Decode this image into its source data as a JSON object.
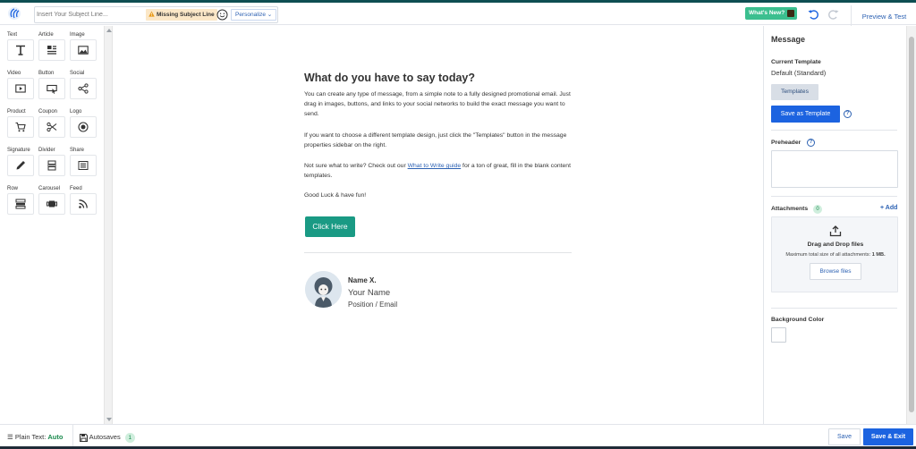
{
  "colors": {
    "accent": "#1c63e0",
    "cta": "#1a9a84",
    "whats_new": "#3bbf8f",
    "warning_bg": "#fbe7c7",
    "success": "#1b8a4e"
  },
  "topbar": {
    "logo_icon": "app-logo-icon",
    "subject_placeholder": "Insert Your Subject Line...",
    "missing_subject": "Missing Subject Line",
    "personalize": "Personalize",
    "whats_new": "What's New?",
    "preview_test": "Preview & Test"
  },
  "blocks": [
    {
      "label": "Text",
      "icon": "text-icon"
    },
    {
      "label": "Article",
      "icon": "article-icon"
    },
    {
      "label": "Image",
      "icon": "image-icon"
    },
    {
      "label": "Video",
      "icon": "video-icon"
    },
    {
      "label": "Button",
      "icon": "button-icon"
    },
    {
      "label": "Social",
      "icon": "share-nodes-icon"
    },
    {
      "label": "Product",
      "icon": "cart-icon"
    },
    {
      "label": "Coupon",
      "icon": "scissors-icon"
    },
    {
      "label": "Logo",
      "icon": "logo-icon"
    },
    {
      "label": "Signature",
      "icon": "pen-icon"
    },
    {
      "label": "Divider",
      "icon": "divider-icon"
    },
    {
      "label": "Share",
      "icon": "share-icon"
    },
    {
      "label": "Row",
      "icon": "row-icon"
    },
    {
      "label": "Carousel",
      "icon": "carousel-icon"
    },
    {
      "label": "Feed",
      "icon": "rss-icon"
    }
  ],
  "email": {
    "heading": "What do you have to say today?",
    "p1": "You can create any type of message, from a simple note to a fully designed promotional email. Just drag in images, buttons, and links to your social networks to build the exact message you want to send.",
    "p2": "If you want to choose a different template design, just click the \"Templates\" button in the message properties sidebar on the right.",
    "p3_before": "Not sure what to write? Check out our ",
    "p3_link": "What to Write guide",
    "p3_after": " for a ton of great, fill in the blank content templates.",
    "p4": "Good Luck & have fun!",
    "cta": "Click Here",
    "signature": {
      "name": "Name X.",
      "your_name": "Your Name",
      "position": "Position / Email"
    }
  },
  "sidebar": {
    "title": "Message",
    "current_template_label": "Current Template",
    "current_template_value": "Default (Standard)",
    "templates_button": "Templates",
    "save_as_template": "Save as Template",
    "help_glyph": "?",
    "preheader_label": "Preheader",
    "attachments_label": "Attachments",
    "attachments_count": "0",
    "add_label": "+ Add",
    "dropzone_title": "Drag and Drop files",
    "dropzone_note_prefix": "Maximum total size of all attachments: ",
    "dropzone_note_value": "1 MB.",
    "browse_files": "Browse files",
    "background_color_label": "Background Color"
  },
  "bottombar": {
    "plain_text_label": "Plain Text:",
    "plain_text_value": "Auto",
    "autosaves_label": "Autosaves",
    "autosaves_count": "1",
    "save": "Save",
    "save_exit": "Save & Exit"
  }
}
